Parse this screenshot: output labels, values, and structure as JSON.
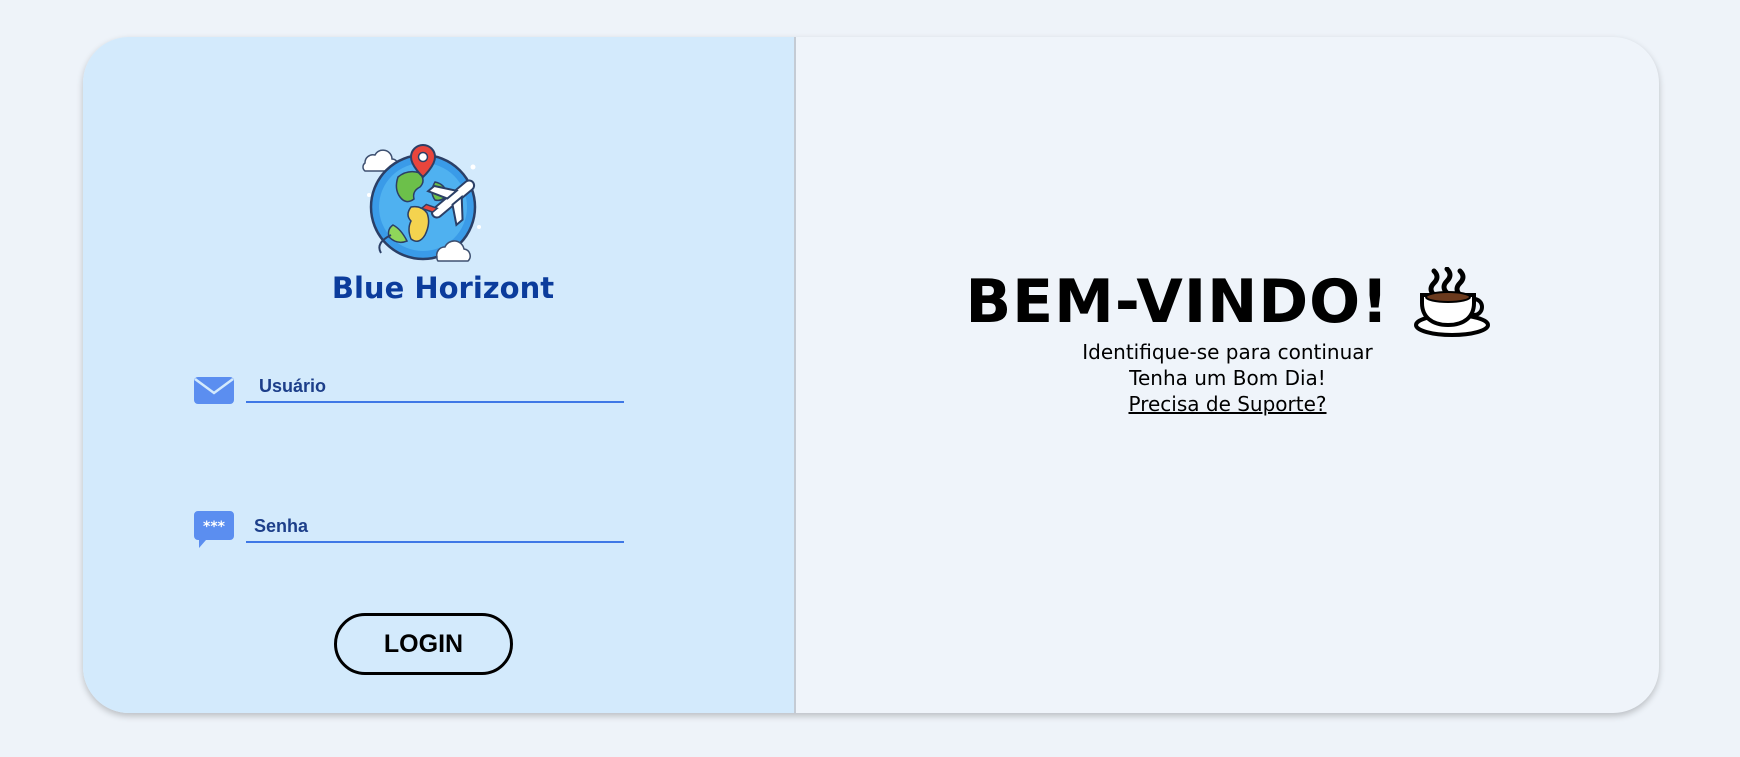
{
  "brand": {
    "name": "Blue Horizont",
    "logo_icon": "globe-plane-icon"
  },
  "login_form": {
    "username": {
      "placeholder": "Usuário",
      "value": "",
      "icon": "envelope-icon"
    },
    "password": {
      "placeholder": "Senha",
      "value": "",
      "icon": "password-bubble-icon"
    },
    "submit_label": "LOGIN"
  },
  "welcome": {
    "title": "BEM-VINDO!",
    "emoji_icon": "coffee-cup-icon",
    "subtitle": "Identifique-se para continuar",
    "greeting": "Tenha um Bom Dia!",
    "support_link": "Precisa de Suporte?"
  },
  "colors": {
    "background": "#eef3f9",
    "left_panel": "#d3eafc",
    "brand_text": "#0b3c9c",
    "accent": "#3f78e6",
    "icon_blue": "#5b8ef0"
  }
}
